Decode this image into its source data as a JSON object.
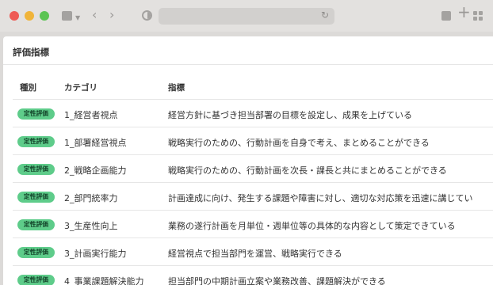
{
  "page": {
    "title": "評価指標"
  },
  "table": {
    "headers": {
      "type": "種別",
      "category": "カテゴリ",
      "indicator": "指標"
    },
    "rows": [
      {
        "badge": "定性評価",
        "category": "1_経営者視点",
        "indicator": "経営方針に基づき担当部署の目標を設定し、成果を上げている"
      },
      {
        "badge": "定性評価",
        "category": "1_部署経営視点",
        "indicator": "戦略実行のための、行動計画を自身で考え、まとめることができる"
      },
      {
        "badge": "定性評価",
        "category": "2_戦略企画能力",
        "indicator": "戦略実行のための、行動計画を次長・課長と共にまとめることができる"
      },
      {
        "badge": "定性評価",
        "category": "2_部門統率力",
        "indicator": "計画達成に向け、発生する課題や障害に対し、適切な対応策を迅速に講じてい"
      },
      {
        "badge": "定性評価",
        "category": "3_生産性向上",
        "indicator": "業務の遂行計画を月単位・週単位等の具体的な内容として策定できている"
      },
      {
        "badge": "定性評価",
        "category": "3_計画実行能力",
        "indicator": "経営視点で担当部門を運営、戦略実行できる"
      },
      {
        "badge": "定性評価",
        "category": "4_事業課題解決能力",
        "indicator": "担当部門の中期計画立案や業務改善、課題解決ができる"
      }
    ]
  }
}
